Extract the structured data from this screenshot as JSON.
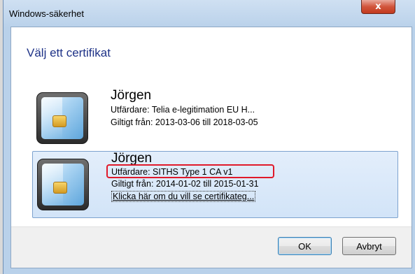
{
  "window": {
    "title": "Windows-säkerhet",
    "close_label": "x"
  },
  "dialog": {
    "heading": "Välj ett certifikat"
  },
  "certificates": [
    {
      "name": "Jörgen",
      "issuer": "Utfärdare: Telia e-legitimation EU H...",
      "validity": "Giltigt från: 2013-03-06 till 2018-03-05"
    },
    {
      "name": "Jörgen",
      "issuer": "Utfärdare: SITHS Type 1 CA v1",
      "validity": "Giltigt från: 2014-01-02 till 2015-01-31",
      "details_link": "Klicka här om du vill se certifikateg..."
    }
  ],
  "buttons": {
    "ok": "OK",
    "cancel": "Avbryt"
  },
  "colors": {
    "heading": "#1e3287",
    "highlight": "#e0192a",
    "selection": "#d2e4f8"
  },
  "icons": {
    "certificate": "smart-card-icon",
    "close": "close-icon"
  }
}
